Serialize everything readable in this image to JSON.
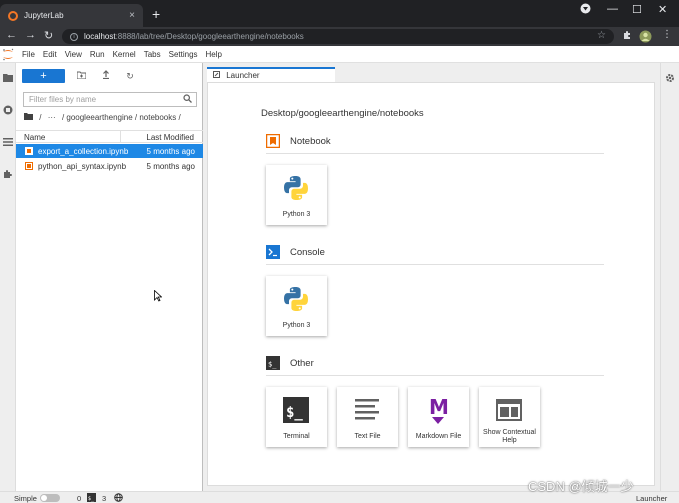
{
  "browser": {
    "tab_title": "JupyterLab",
    "tab_close": "×",
    "new_tab": "+",
    "url_host": "localhost",
    "url_rest": ":8888/lab/tree/Desktop/googleearthengine/notebooks",
    "win_minimize": "—",
    "win_maximize": "☐",
    "win_close": "✕",
    "back": "←",
    "forward": "→",
    "reload": "↻"
  },
  "menubar": {
    "items": [
      "File",
      "Edit",
      "View",
      "Run",
      "Kernel",
      "Tabs",
      "Settings",
      "Help"
    ]
  },
  "filebrowser": {
    "new_launcher_label": "+",
    "filter_placeholder": "Filter files by name",
    "breadcrumb": [
      "/",
      "···",
      "/ googleearthengine / notebooks /"
    ],
    "columns": {
      "name": "Name",
      "modified": "Last Modified"
    },
    "files": [
      {
        "name": "export_a_collection.ipynb",
        "modified": "5 months ago",
        "selected": true
      },
      {
        "name": "python_api_syntax.ipynb",
        "modified": "5 months ago",
        "selected": false
      }
    ]
  },
  "main": {
    "tab_label": "Launcher",
    "launcher_path": "Desktop/googleearthengine/notebooks",
    "sections": {
      "notebook": {
        "title": "Notebook",
        "cards": [
          "Python 3"
        ]
      },
      "console": {
        "title": "Console",
        "cards": [
          "Python 3"
        ]
      },
      "other": {
        "title": "Other",
        "cards": [
          "Terminal",
          "Text File",
          "Markdown File",
          "Show Contextual Help"
        ]
      }
    },
    "console_icon_text": ">_",
    "other_icon_text": "$_",
    "terminal_icon_text": "$_",
    "markdown_icon_text": "M"
  },
  "statusbar": {
    "simple_label": "Simple",
    "kernels_count": "0",
    "terminals_count": "3",
    "terminal_icon_text": "$_",
    "right_label": "Launcher"
  },
  "watermark": "CSDN @倾城一少",
  "colors": {
    "accent": "#1976d2",
    "selected_row": "#1e88e5",
    "notebook_orange": "#ef6c00",
    "markdown_purple": "#7b1fa2",
    "python_blue": "#3572A5",
    "python_yellow": "#FFD43B"
  }
}
